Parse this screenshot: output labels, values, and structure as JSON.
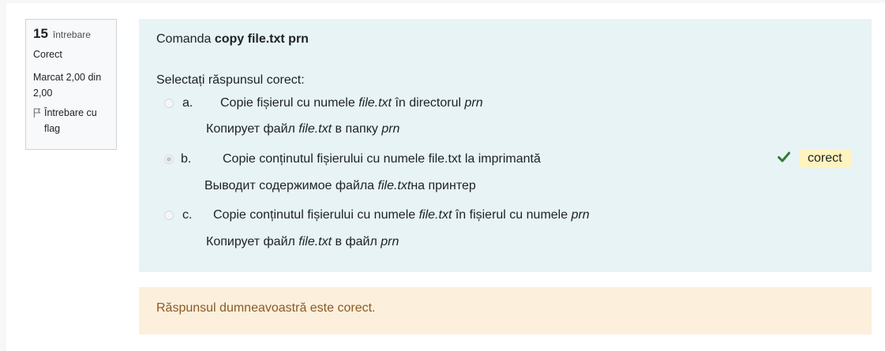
{
  "question_info": {
    "number": "15",
    "number_label": "întrebare",
    "state": "Corect",
    "grade": "Marcat 2,00 din 2,00",
    "flag_label": "Întrebare cu flag"
  },
  "question": {
    "text_prefix": "Comanda ",
    "command": "copy file.txt prn",
    "prompt": "Selectați răspunsul corect:"
  },
  "answers": [
    {
      "letter": "a.",
      "ro": {
        "t1": "Copie  fișierul cu numele ",
        "i1": "file.txt",
        "t2": " în directorul ",
        "i2": "prn",
        "t3": ""
      },
      "ru": {
        "t1": "Копирует файл ",
        "i1": "file.txt",
        "t2": " в папку ",
        "i2": "prn",
        "t3": ""
      },
      "selected": false
    },
    {
      "letter": "b.",
      "ro": {
        "t1": "Copie conținutul fișierului cu numele file.txt la imprimantă",
        "i1": "",
        "t2": "",
        "i2": "",
        "t3": ""
      },
      "ru": {
        "t1": "Выводит содержимое файла ",
        "i1": "file.txt",
        "t2": "на принтер",
        "i2": "",
        "t3": ""
      },
      "selected": true,
      "status_icon": "check-icon",
      "badge": "corect"
    },
    {
      "letter": "c.",
      "ro": {
        "t1": "Copie conținutul fișierului cu numele ",
        "i1": "file.txt",
        "t2": " în fișierul cu numele ",
        "i2": "prn",
        "t3": ""
      },
      "ru": {
        "t1": "Копирует файл ",
        "i1": "file.txt",
        "t2": " в файл ",
        "i2": "prn",
        "t3": ""
      },
      "selected": false
    }
  ],
  "feedback": "Răspunsul dumneavoastră este corect.",
  "colors": {
    "content_bg": "#e7f3f5",
    "feedback_bg": "#fcefdc",
    "feedback_text": "#8a5a24",
    "badge_bg": "#fff3bf",
    "check": "#357a32"
  }
}
